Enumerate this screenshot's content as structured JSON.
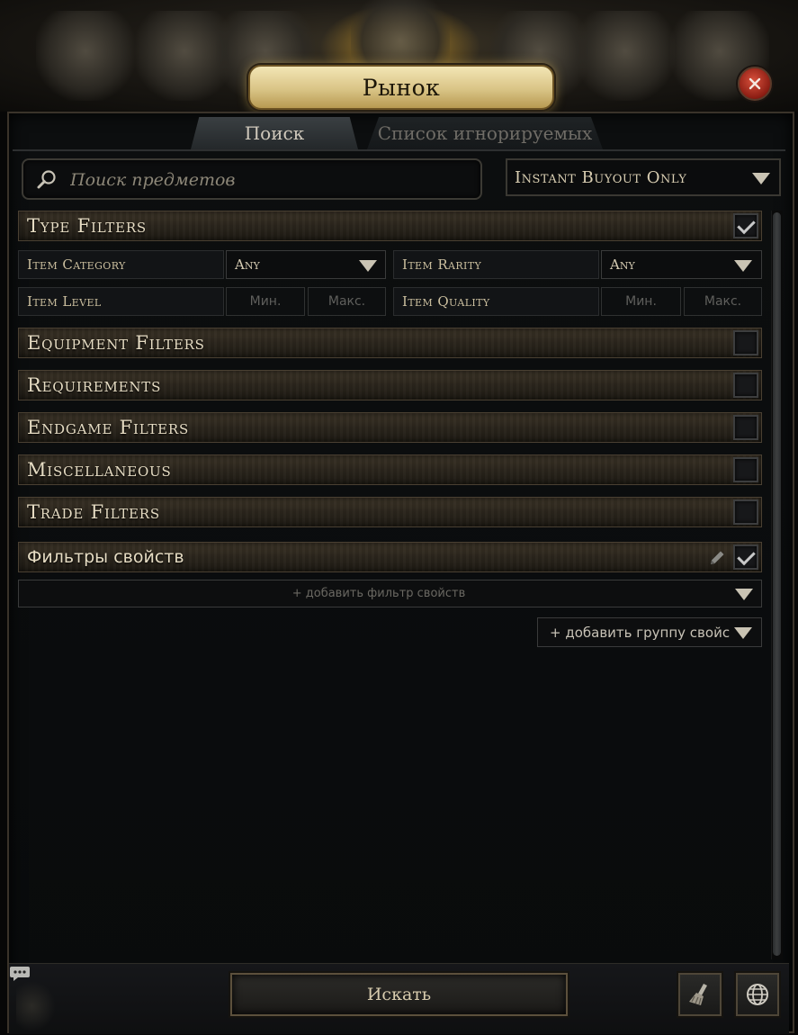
{
  "window": {
    "title": "Рынок"
  },
  "tabs": [
    {
      "label": "Поиск",
      "active": true
    },
    {
      "label": "Список игнорируемых",
      "active": false
    }
  ],
  "search": {
    "placeholder": "Поиск предметов",
    "value": ""
  },
  "buyout": {
    "selected": "Instant Buyout Only"
  },
  "sections": {
    "type_filters": {
      "label": "Type Filters",
      "checked": true
    },
    "equipment": {
      "label": "Equipment Filters",
      "checked": false
    },
    "requirements": {
      "label": "Requirements",
      "checked": false
    },
    "endgame": {
      "label": "Endgame Filters",
      "checked": false
    },
    "misc": {
      "label": "Miscellaneous",
      "checked": false
    },
    "trade": {
      "label": "Trade Filters",
      "checked": false
    },
    "stat_filters": {
      "label": "Фильтры свойств",
      "checked": true
    }
  },
  "type_filters": {
    "item_category": {
      "label": "Item Category",
      "value": "Any"
    },
    "item_rarity": {
      "label": "Item Rarity",
      "value": "Any"
    },
    "item_level": {
      "label": "Item Level",
      "min_placeholder": "Мин.",
      "max_placeholder": "Макс."
    },
    "item_quality": {
      "label": "Item Quality",
      "min_placeholder": "Мин.",
      "max_placeholder": "Макс."
    }
  },
  "stat_filters": {
    "add_filter": "+ добавить фильтр свойств",
    "add_group": "+ добавить группу свойс"
  },
  "footer": {
    "search_button": "Искать"
  },
  "icons": {
    "close": "close-icon",
    "search": "search-icon",
    "pencil": "pencil-icon",
    "broom": "broom-icon",
    "globe": "globe-icon",
    "chat": "chat-icon"
  },
  "colors": {
    "accent_gold": "#d9c486",
    "close_red": "#b8301f",
    "text": "#e6dcc3"
  }
}
